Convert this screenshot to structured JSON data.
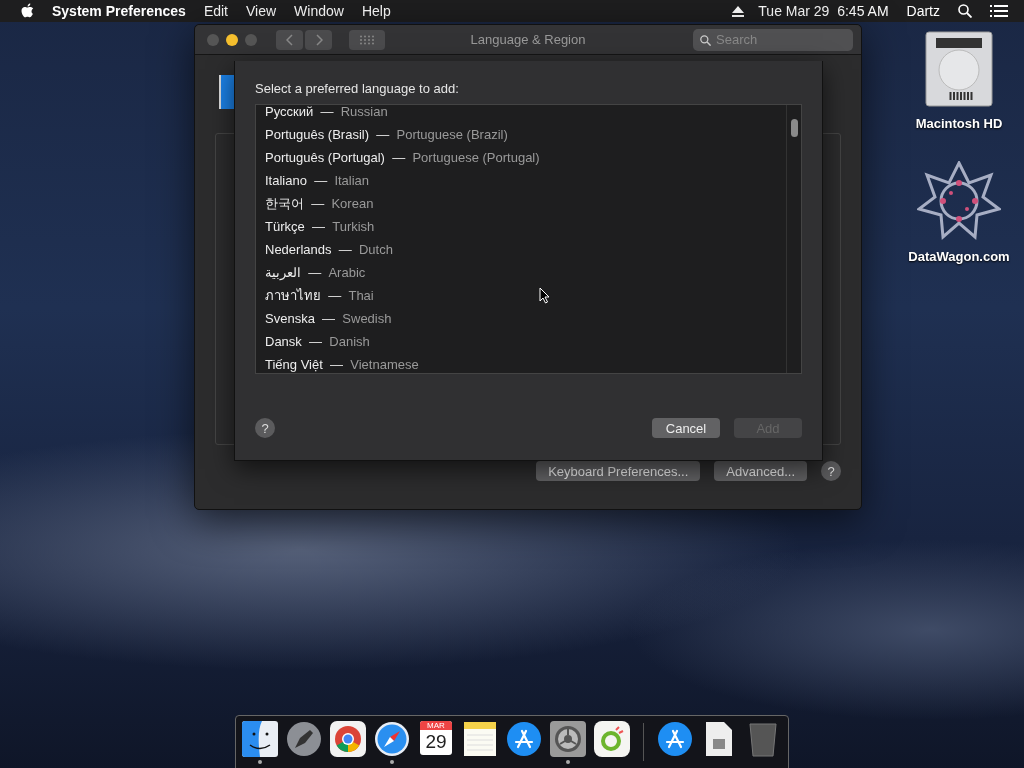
{
  "menu_bar": {
    "app_name": "System Preferences",
    "menus": [
      "Edit",
      "View",
      "Window",
      "Help"
    ],
    "clock": "Tue Mar 29  6:45 AM",
    "user": "Dartz"
  },
  "window": {
    "title": "Language & Region",
    "search": {
      "placeholder": "Search"
    },
    "buttons": [
      "Keyboard Preferences...",
      "Advanced..."
    ],
    "help": "?"
  },
  "sheet": {
    "prompt": "Select a preferred language to add:",
    "languages": [
      {
        "native": "Русский",
        "english": "Russian"
      },
      {
        "native": "Português (Brasil)",
        "english": "Portuguese (Brazil)"
      },
      {
        "native": "Português (Portugal)",
        "english": "Portuguese (Portugal)"
      },
      {
        "native": "Italiano",
        "english": "Italian"
      },
      {
        "native": "한국어",
        "english": "Korean"
      },
      {
        "native": "Türkçe",
        "english": "Turkish"
      },
      {
        "native": "Nederlands",
        "english": "Dutch"
      },
      {
        "native": "العربية",
        "english": "Arabic"
      },
      {
        "native": "ภาษาไทย",
        "english": "Thai"
      },
      {
        "native": "Svenska",
        "english": "Swedish"
      },
      {
        "native": "Dansk",
        "english": "Danish"
      },
      {
        "native": "Tiếng Việt",
        "english": "Vietnamese"
      }
    ],
    "separator": "—",
    "help": "?",
    "cancel": {
      "label": "Cancel",
      "disabled": false
    },
    "add": {
      "label": "Add",
      "disabled": true
    }
  },
  "desktop_icons": [
    {
      "kind": "disk",
      "label": "Macintosh HD"
    },
    {
      "kind": "star",
      "label": "DataWagon.com"
    }
  ],
  "dock": [
    {
      "kind": "finder",
      "running": true
    },
    {
      "kind": "launchpad",
      "running": false
    },
    {
      "kind": "chrome",
      "running": false
    },
    {
      "kind": "safari",
      "running": true
    },
    {
      "kind": "calendar",
      "running": false,
      "month": "MAR",
      "day": "29"
    },
    {
      "kind": "notes",
      "running": false
    },
    {
      "kind": "appstore",
      "running": false
    },
    {
      "kind": "prefs",
      "running": true
    },
    {
      "kind": "app",
      "running": false
    },
    {
      "kind": "divider"
    },
    {
      "kind": "appstore",
      "running": false
    },
    {
      "kind": "file",
      "running": false
    },
    {
      "kind": "trash",
      "running": false
    }
  ]
}
